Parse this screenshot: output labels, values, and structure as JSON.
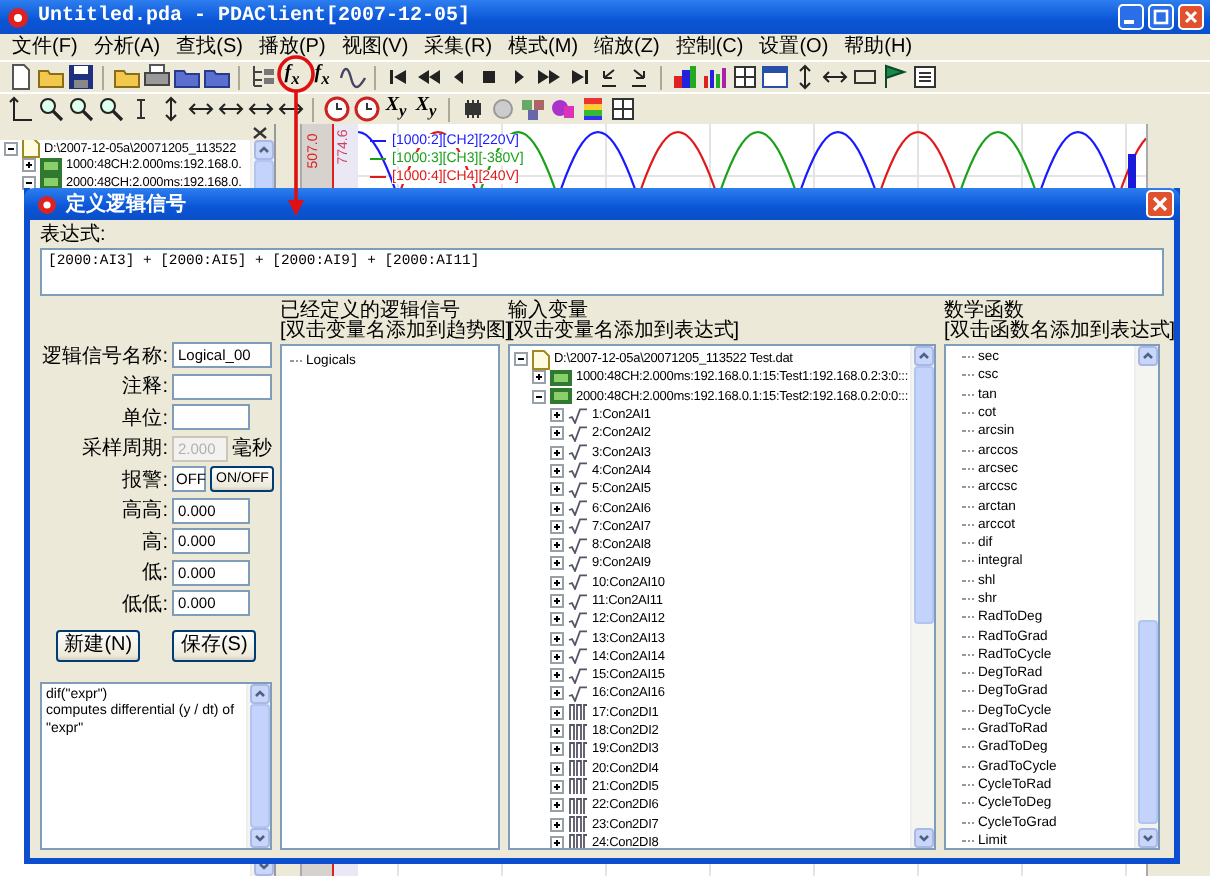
{
  "window": {
    "title": "Untitled.pda - PDAClient[2007-12-05]"
  },
  "menu": [
    "文件(F)",
    "分析(A)",
    "查找(S)",
    "播放(P)",
    "视图(V)",
    "采集(R)",
    "模式(M)",
    "缩放(Z)",
    "控制(C)",
    "设置(O)",
    "帮助(H)"
  ],
  "toolbar_labels": [
    "f$_{x}$",
    "f$_{x}$",
    "X$_{y}$",
    "X$_{y}$"
  ],
  "navigator": {
    "tree": [
      {
        "label": "D:\\2007-12-05a\\20071205_113522",
        "kind": "file",
        "expanded": true,
        "children": [
          {
            "label": "1000:48CH:2.000ms:192.168.0.",
            "kind": "device",
            "expanded": false
          },
          {
            "label": "2000:48CH:2.000ms:192.168.0.",
            "kind": "device",
            "expanded": true
          }
        ]
      }
    ]
  },
  "chart": {
    "axis_labels": [
      "507.0",
      "774.6"
    ],
    "legend": [
      {
        "label": "[1000:2][CH2][220V]",
        "color": "#1a1aff"
      },
      {
        "label": "[1000:3][CH3][-380V]",
        "color": "#1aa01a"
      },
      {
        "label": "[1000:4][CH4][240V]",
        "color": "#e01a1a"
      }
    ]
  },
  "dialog": {
    "title": "定义逻辑信号",
    "expression_label": "表达式:",
    "expression": "[2000:AI3] + [2000:AI5] + [2000:AI9] + [2000:AI11]",
    "fields": [
      {
        "label": "逻辑信号名称:",
        "value": "Logical_00",
        "kind": "text",
        "disabled": false
      },
      {
        "label": "注释:",
        "kind": "text",
        "disabled": false
      },
      {
        "label": "单位:",
        "kind": "text",
        "disabled": false
      },
      {
        "label": "采样周期:",
        "value": "2.000",
        "unit": "毫秒",
        "kind": "text",
        "disabled": true
      },
      {
        "label": "报警:",
        "value": "OFF",
        "button": "ON/OFF",
        "kind": "alarm",
        "disabled": false
      },
      {
        "label": "高高:",
        "value": "0.000",
        "kind": "text",
        "disabled": false
      },
      {
        "label": "高:",
        "value": "0.000",
        "kind": "text",
        "disabled": false
      },
      {
        "label": "低:",
        "value": "0.000",
        "kind": "text",
        "disabled": false
      },
      {
        "label": "低低:",
        "value": "0.000",
        "kind": "text",
        "disabled": false
      }
    ],
    "buttons": [
      "新建(N)",
      "保存(S)"
    ],
    "help_text": "dif(\"expr\")\ncomputes differential (y / dt) of \"expr\"",
    "logical_signals": {
      "header": "已经定义的逻辑信号",
      "hint": "[双击变量名添加到趋势图]",
      "items": [
        "Logicals"
      ]
    },
    "inputs": {
      "header": "输入变量",
      "hint": "[双击变量名添加到表达式]",
      "tree": [
        {
          "label": "D:\\2007-12-05a\\20071205_113522 Test.dat",
          "kind": "file",
          "expanded": true,
          "children": [
            {
              "label": "1000:48CH:2.000ms:192.168.0.1:15:Test1:192.168.0.2:3:0:::",
              "kind": "device",
              "expanded": false
            },
            {
              "label": "2000:48CH:2.000ms:192.168.0.1:15:Test2:192.168.0.2:0:0:::",
              "kind": "device",
              "expanded": true,
              "children": [
                {
                  "label": "1:Con2AI1",
                  "kind": "analog",
                  "expanded": false
                },
                {
                  "label": "2:Con2AI2",
                  "kind": "analog",
                  "expanded": false
                },
                {
                  "label": "3:Con2AI3",
                  "kind": "analog",
                  "expanded": false
                },
                {
                  "label": "4:Con2AI4",
                  "kind": "analog",
                  "expanded": false
                },
                {
                  "label": "5:Con2AI5",
                  "kind": "analog",
                  "expanded": false
                },
                {
                  "label": "6:Con2AI6",
                  "kind": "analog",
                  "expanded": false
                },
                {
                  "label": "7:Con2AI7",
                  "kind": "analog",
                  "expanded": false
                },
                {
                  "label": "8:Con2AI8",
                  "kind": "analog",
                  "expanded": false
                },
                {
                  "label": "9:Con2AI9",
                  "kind": "analog",
                  "expanded": false
                },
                {
                  "label": "10:Con2AI10",
                  "kind": "analog",
                  "expanded": false
                },
                {
                  "label": "11:Con2AI11",
                  "kind": "analog",
                  "expanded": false
                },
                {
                  "label": "12:Con2AI12",
                  "kind": "analog",
                  "expanded": false
                },
                {
                  "label": "13:Con2AI13",
                  "kind": "analog",
                  "expanded": false
                },
                {
                  "label": "14:Con2AI14",
                  "kind": "analog",
                  "expanded": false
                },
                {
                  "label": "15:Con2AI15",
                  "kind": "analog",
                  "expanded": false
                },
                {
                  "label": "16:Con2AI16",
                  "kind": "analog",
                  "expanded": false
                },
                {
                  "label": "17:Con2DI1",
                  "kind": "digital",
                  "expanded": false
                },
                {
                  "label": "18:Con2DI2",
                  "kind": "digital",
                  "expanded": false
                },
                {
                  "label": "19:Con2DI3",
                  "kind": "digital",
                  "expanded": false
                },
                {
                  "label": "20:Con2DI4",
                  "kind": "digital",
                  "expanded": false
                },
                {
                  "label": "21:Con2DI5",
                  "kind": "digital",
                  "expanded": false
                },
                {
                  "label": "22:Con2DI6",
                  "kind": "digital",
                  "expanded": false
                },
                {
                  "label": "23:Con2DI7",
                  "kind": "digital",
                  "expanded": false
                },
                {
                  "label": "24:Con2DI8",
                  "kind": "digital",
                  "expanded": false
                }
              ]
            }
          ]
        }
      ]
    },
    "functions": {
      "header": "数学函数",
      "hint": "[双击函数名添加到表达式]",
      "items": [
        "sec",
        "csc",
        "tan",
        "cot",
        "arcsin",
        "arccos",
        "arcsec",
        "arccsc",
        "arctan",
        "arccot",
        "dif",
        "integral",
        "shl",
        "shr",
        "RadToDeg",
        "RadToGrad",
        "RadToCycle",
        "DegToRad",
        "DegToGrad",
        "DegToCycle",
        "GradToRad",
        "GradToDeg",
        "GradToCycle",
        "CycleToRad",
        "CycleToDeg",
        "CycleToGrad",
        "Limit"
      ]
    }
  }
}
